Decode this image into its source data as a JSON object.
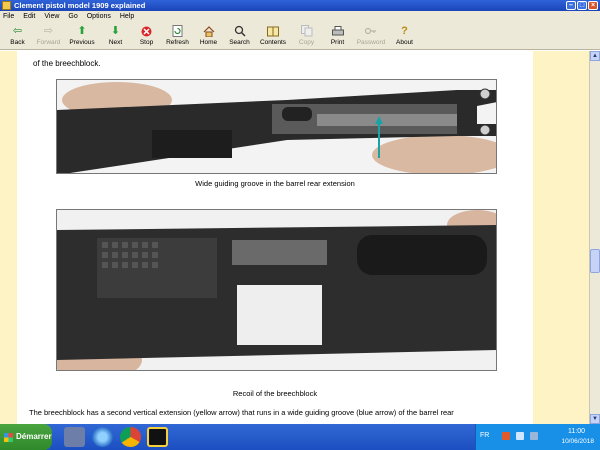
{
  "window": {
    "title": "Clement pistol model 1909 explained"
  },
  "menu": [
    "File",
    "Edit",
    "View",
    "Go",
    "Options",
    "Help"
  ],
  "toolbar": [
    {
      "label": "Back",
      "icon": "back-arrow-icon",
      "enabled": true
    },
    {
      "label": "Forward",
      "icon": "forward-arrow-icon",
      "enabled": false
    },
    {
      "label": "Previous",
      "icon": "up-arrow-icon",
      "enabled": true
    },
    {
      "label": "Next",
      "icon": "down-arrow-icon",
      "enabled": true
    },
    {
      "label": "Stop",
      "icon": "stop-icon",
      "enabled": true
    },
    {
      "label": "Refresh",
      "icon": "refresh-icon",
      "enabled": true
    },
    {
      "label": "Home",
      "icon": "home-icon",
      "enabled": true
    },
    {
      "label": "Search",
      "icon": "search-icon",
      "enabled": true
    },
    {
      "label": "Contents",
      "icon": "contents-icon",
      "enabled": true
    },
    {
      "label": "Copy",
      "icon": "copy-icon",
      "enabled": false
    },
    {
      "label": "Print",
      "icon": "print-icon",
      "enabled": true
    },
    {
      "label": "Password",
      "icon": "key-icon",
      "enabled": false
    },
    {
      "label": "About",
      "icon": "about-icon",
      "enabled": true
    }
  ],
  "document": {
    "intro": "of the breechblock.",
    "caption1": "Wide guiding groove in the barrel rear extension",
    "caption2": "Recoil of the breechblock",
    "body": "The breechblock has a second vertical extension (yellow arrow) that runs in a wide guiding groove (blue arrow) of the barrel rear"
  },
  "taskbar": {
    "start_label": "Démarrer",
    "language": "FR",
    "time": "11:00",
    "date": "10/06/2018"
  },
  "colors": {
    "page_margin": "#fdf3c4",
    "titlebar": "#2f62d8",
    "annotation_arrow": "#1aa3a6"
  }
}
